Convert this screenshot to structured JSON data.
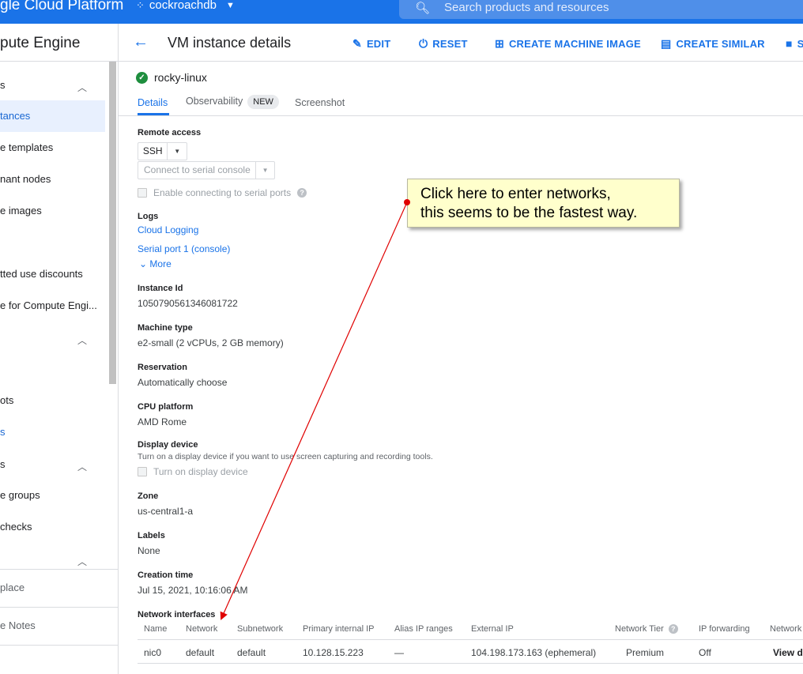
{
  "topbar": {
    "brand": "gle Cloud Platform",
    "project": "cockroachdb",
    "search_placeholder": "Search products and resources"
  },
  "sidebar": {
    "title": "pute Engine",
    "items": [
      {
        "label": "s"
      },
      {
        "label": "tances"
      },
      {
        "label": "e templates"
      },
      {
        "label": "nant nodes"
      },
      {
        "label": "e images"
      },
      {
        "label": "tted use discounts"
      },
      {
        "label": "e for Compute Engi..."
      },
      {
        "label": "ots"
      },
      {
        "label": "s"
      },
      {
        "label": "s"
      },
      {
        "label": "e groups"
      },
      {
        "label": "checks"
      },
      {
        "label": "place"
      },
      {
        "label": "e Notes"
      }
    ]
  },
  "actionbar": {
    "title": "VM instance details",
    "edit": "EDIT",
    "reset": "RESET",
    "create_image": "CREATE MACHINE IMAGE",
    "create_similar": "CREATE SIMILAR",
    "more_initial": "S"
  },
  "instance": {
    "name": "rocky-linux"
  },
  "tabs": {
    "details": "Details",
    "observability": "Observability",
    "new_badge": "NEW",
    "screenshot": "Screenshot"
  },
  "details": {
    "remote_access_label": "Remote access",
    "ssh": "SSH",
    "serial_console": "Connect to serial console",
    "enable_serial": "Enable connecting to serial ports",
    "logs_label": "Logs",
    "cloud_logging": "Cloud Logging",
    "serial_port": "Serial port 1 (console)",
    "more": "More",
    "instance_id_label": "Instance Id",
    "instance_id": "1050790561346081722",
    "machine_type_label": "Machine type",
    "machine_type": "e2-small (2 vCPUs, 2 GB memory)",
    "reservation_label": "Reservation",
    "reservation": "Automatically choose",
    "cpu_label": "CPU platform",
    "cpu": "AMD Rome",
    "display_label": "Display device",
    "display_hint": "Turn on a display device if you want to use screen capturing and recording tools.",
    "display_checkbox": "Turn on display device",
    "zone_label": "Zone",
    "zone": "us-central1-a",
    "labels_label": "Labels",
    "labels": "None",
    "creation_label": "Creation time",
    "creation": "Jul 15, 2021, 10:16:06 AM",
    "network_label": "Network interfaces"
  },
  "network_table": {
    "headers": {
      "name": "Name",
      "network": "Network",
      "subnetwork": "Subnetwork",
      "primary_ip": "Primary internal IP",
      "alias": "Alias IP ranges",
      "external": "External IP",
      "tier": "Network Tier",
      "forwarding": "IP forwarding",
      "details": "Network"
    },
    "row": {
      "name": "nic0",
      "network": "default",
      "subnetwork": "default",
      "primary_ip": "10.128.15.223",
      "alias": "—",
      "external": "104.198.173.163 (ephemeral)",
      "tier": "Premium",
      "forwarding": "Off",
      "details": "View de"
    }
  },
  "annotation": {
    "line1": "Click here to enter networks,",
    "line2": "this seems to be the fastest way."
  },
  "colors": {
    "brand_blue": "#1a73e8",
    "callout_bg": "#ffffcc",
    "arrow": "#e00000",
    "ok_green": "#1e8e3e"
  }
}
